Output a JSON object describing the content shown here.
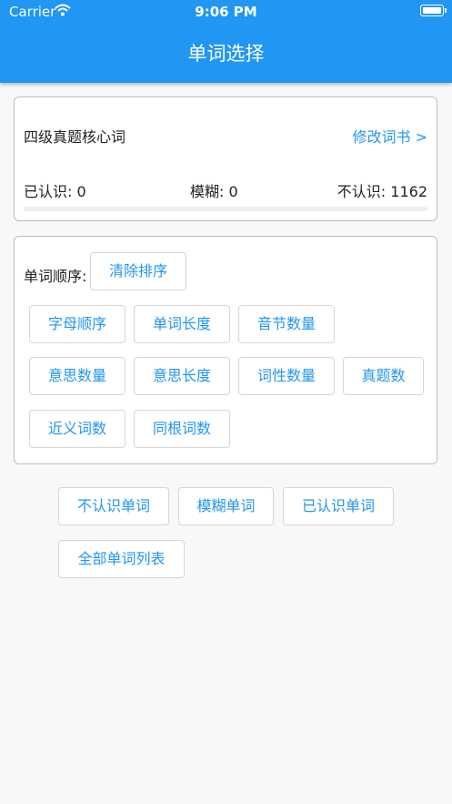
{
  "status_bar": {
    "carrier": "Carrier",
    "time": "9:06 PM"
  },
  "header": {
    "title": "单词选择"
  },
  "book_card": {
    "book_name": "四级真题核心词",
    "change_book": "修改词书 >",
    "known": "已认识: 0",
    "fuzzy": "模糊: 0",
    "unknown": "不认识: 1162",
    "progress": 0
  },
  "sort_card": {
    "label": "单词顺序:",
    "clear_sort": "清除排序",
    "options": [
      "字母顺序",
      "单词长度",
      "音节数量",
      "意思数量",
      "意思长度",
      "词性数量",
      "真题数",
      "近义词数",
      "同根词数"
    ]
  },
  "filters": [
    "不认识单词",
    "模糊单词",
    "已认识单词",
    "全部单词列表"
  ],
  "colors": {
    "primary": "#2196f3",
    "background": "#f8f8f8"
  }
}
